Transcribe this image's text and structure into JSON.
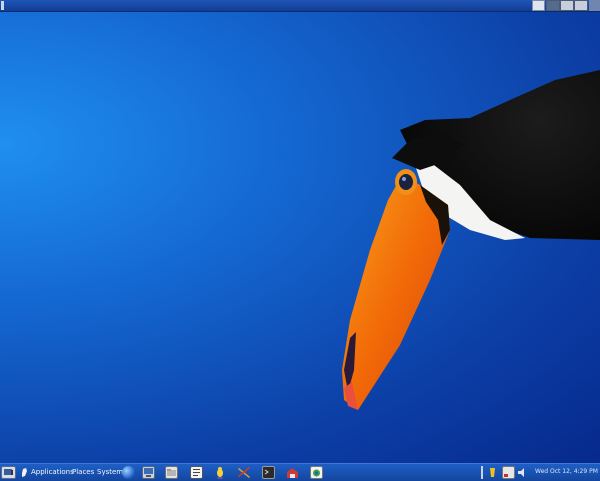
{
  "top_panel": {
    "icons": [
      "show-desktop-icon",
      "workspace-1",
      "workspace-2",
      "workspace-3"
    ]
  },
  "bottom_panel": {
    "menus": {
      "applications": "Applications",
      "places": "Places",
      "system": "System"
    },
    "launchers": [
      "web-browser-icon",
      "computer-icon",
      "file-manager-icon",
      "document-icon",
      "pidgin-icon",
      "tools-icon",
      "terminal-icon",
      "network-icon",
      "software-icon"
    ],
    "tray": {
      "clock": "Wed Oct 12,   4:29 PM"
    }
  },
  "colors": {
    "panel": "#1a55b5",
    "desktop": "#1466cf",
    "toucan_beak": "#f28a10"
  }
}
